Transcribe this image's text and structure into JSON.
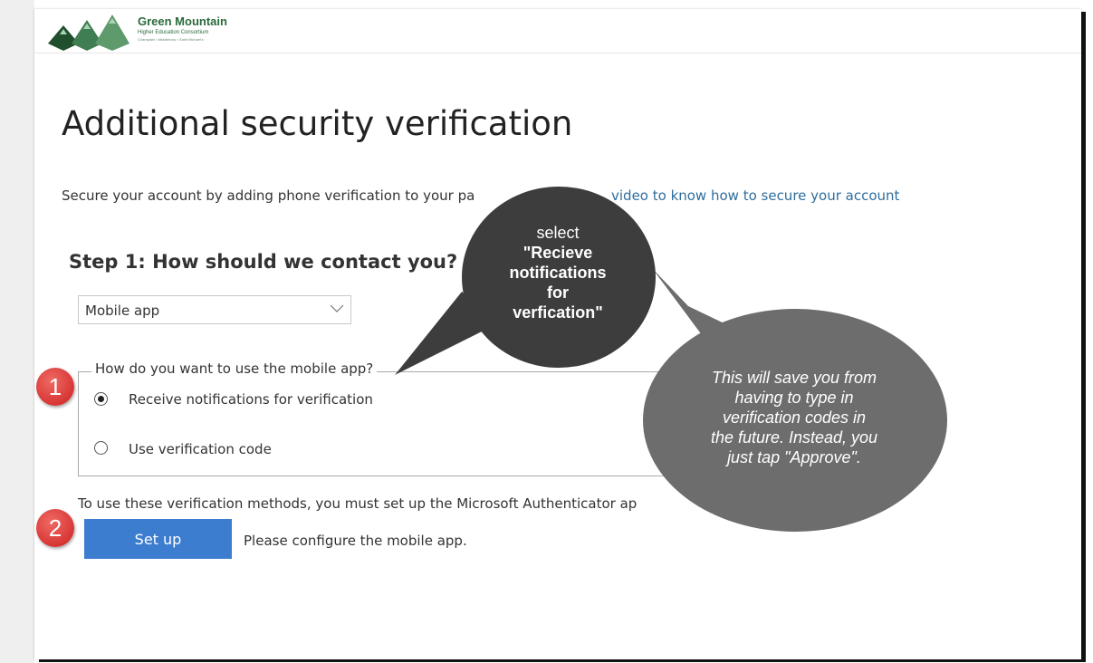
{
  "header": {
    "logo": {
      "name": "Green Mountain",
      "subtitle": "Higher Education Consortium",
      "members": "Champlain • Middlebury • Saint Michael's"
    }
  },
  "main": {
    "title": "Additional security verification",
    "intro_text": "Secure your account by adding phone verification to your pa",
    "intro_link": "video to know how to secure your account",
    "step_title": "Step 1: How should we contact you?",
    "contact_method": {
      "selected": "Mobile app"
    },
    "mobile_app_usage": {
      "legend": "How do you want to use the mobile app?",
      "options": [
        {
          "label": "Receive notifications for verification",
          "checked": true
        },
        {
          "label": "Use verification code",
          "checked": false
        }
      ]
    },
    "setup_note": "To use these verification methods, you must set up the Microsoft Authenticator ap",
    "setup_button_label": "Set up",
    "configure_message": "Please configure the mobile app."
  },
  "annotations": {
    "step_badges": [
      "1",
      "2"
    ],
    "callout_select": {
      "lead": "select",
      "emphasis_lines": [
        "\"Recieve",
        "notifications",
        "for",
        "verfication\""
      ]
    },
    "callout_info": {
      "lines": [
        "This will save you from",
        "having to type in",
        "verification codes in",
        "the future. Instead, you",
        "just tap \"Approve\"."
      ]
    },
    "colors": {
      "badge": "#d9302c",
      "dark_callout": "#3d3d3d",
      "gray_callout": "#6d6d6d",
      "link": "#2f6e9e",
      "button": "#3c7dd0",
      "logo": "#2a6a3c"
    }
  }
}
